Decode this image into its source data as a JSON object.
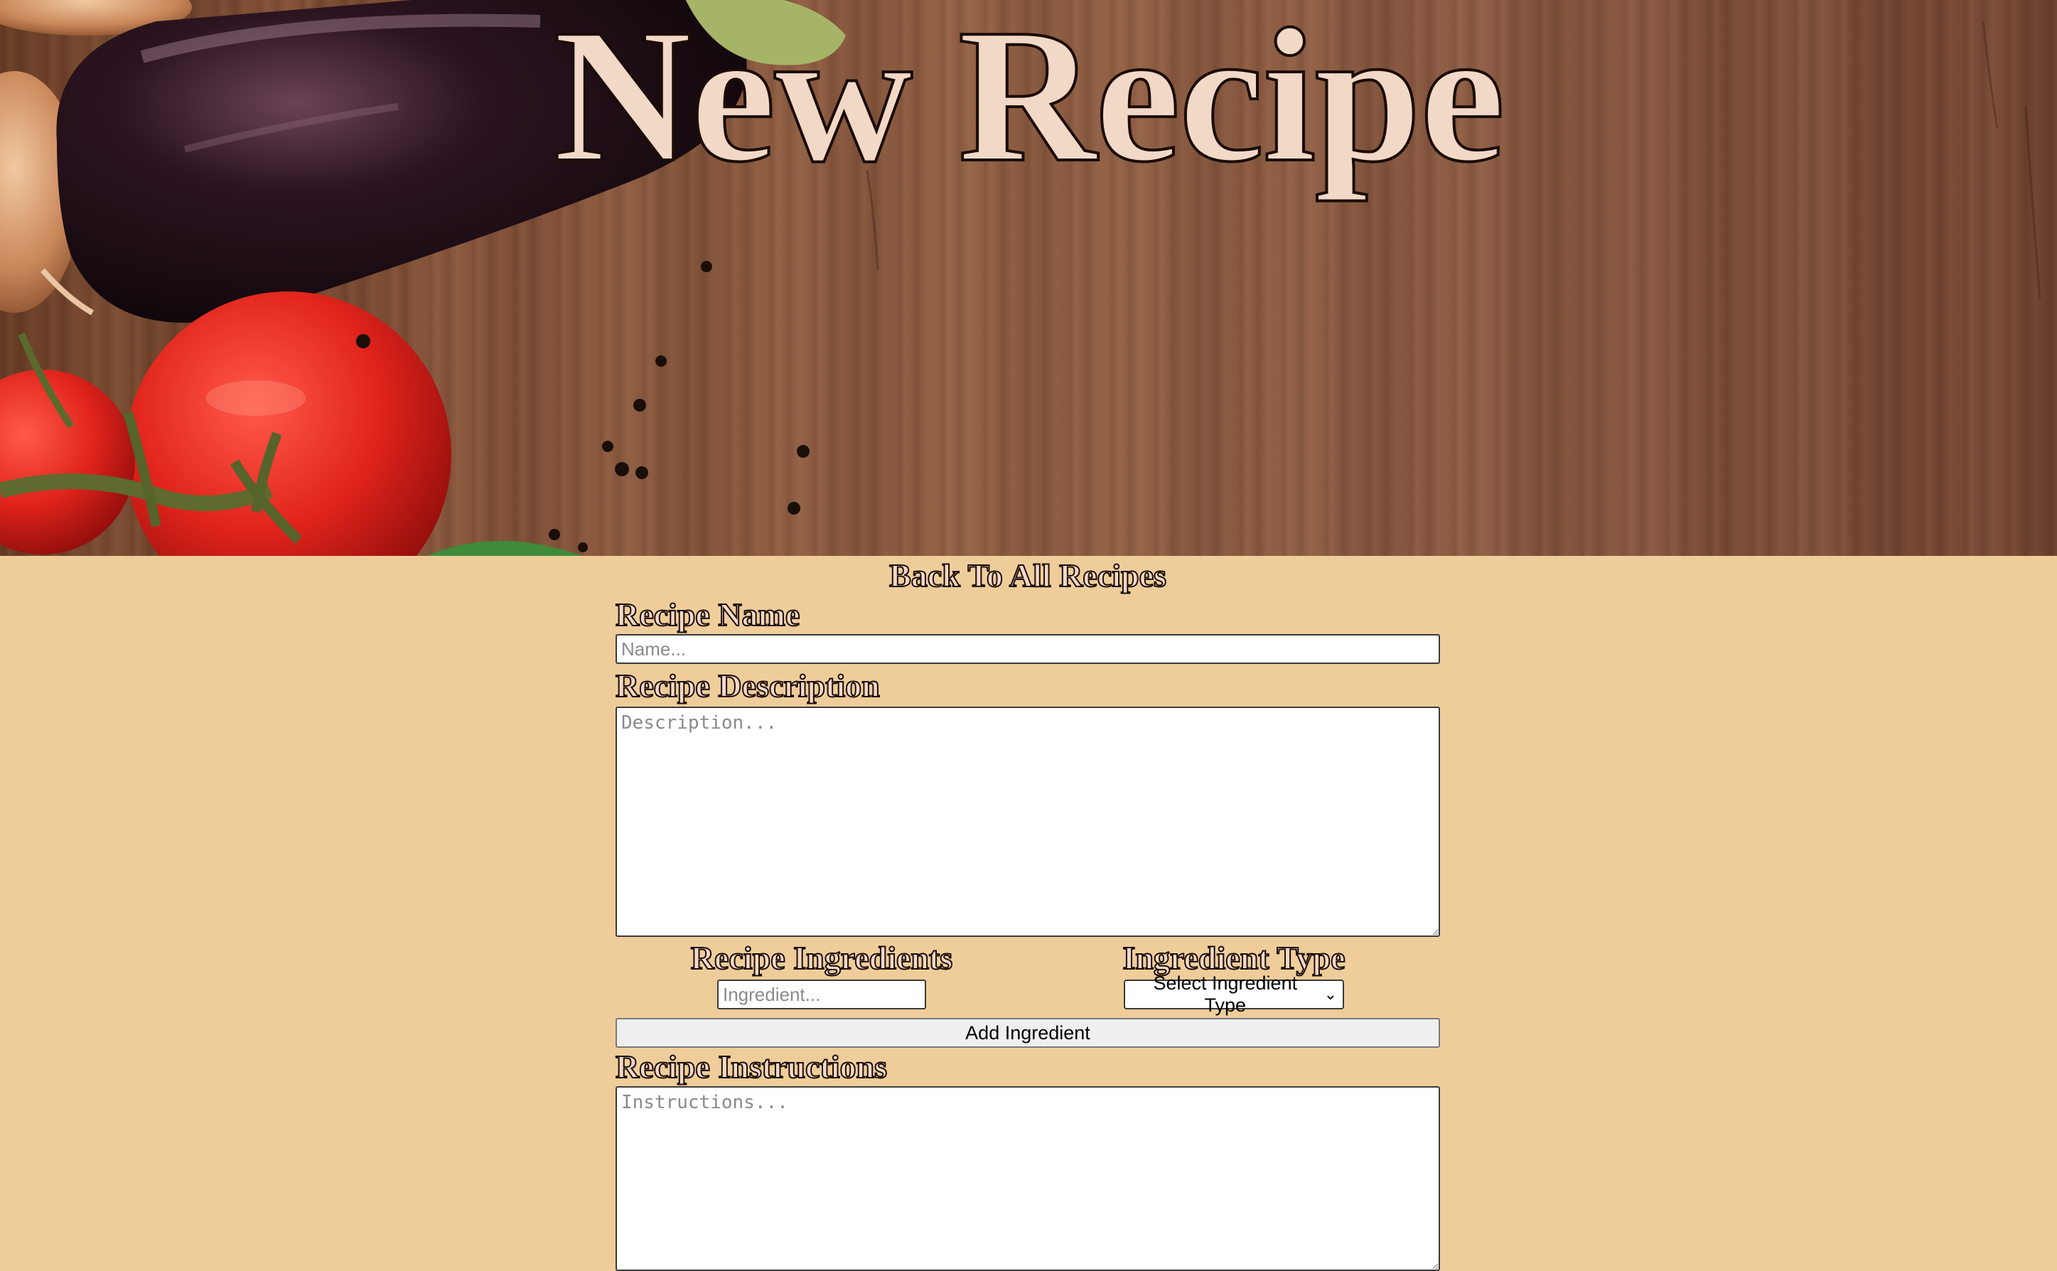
{
  "header": {
    "title": "New Recipe"
  },
  "nav": {
    "back_label": "Back To All Recipes"
  },
  "form": {
    "name_label": "Recipe Name",
    "name_placeholder": "Name...",
    "description_label": "Recipe Description",
    "description_placeholder": "Description...",
    "ingredients_label": "Recipe Ingredients",
    "ingredient_placeholder": "Ingredient...",
    "ingredient_type_label": "Ingredient Type",
    "ingredient_type_selected": "Select Ingredient Type",
    "add_ingredient_label": "Add Ingredient",
    "instructions_label": "Recipe Instructions",
    "instructions_placeholder": "Instructions..."
  },
  "colors": {
    "page_background": "#efcd9a",
    "heading_fill": "#f2d8c7",
    "heading_outline": "#1a0c05"
  }
}
